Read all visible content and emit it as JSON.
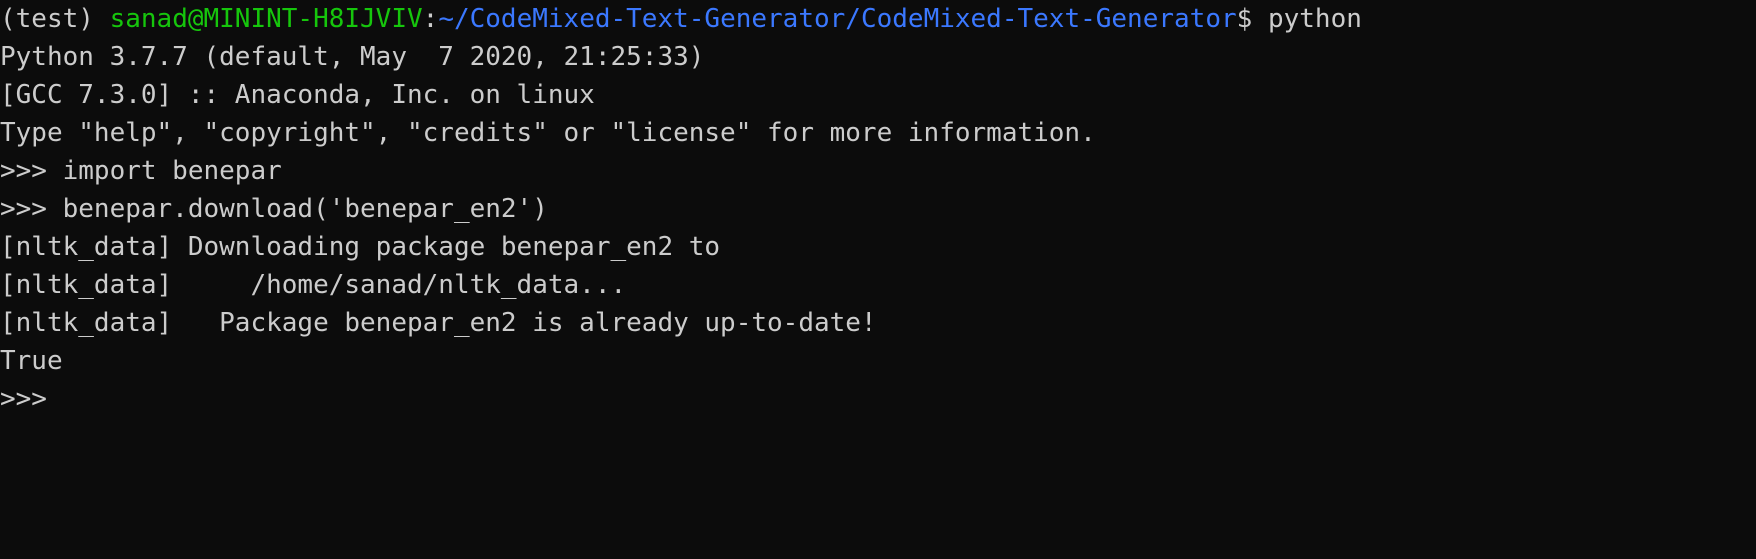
{
  "colors": {
    "background": "#0c0c0c",
    "foreground": "#cccccc",
    "user_host": "#16c60c",
    "path": "#3b78ff"
  },
  "prompt": {
    "env": "(test) ",
    "user_host": "sanad@MININT-H8IJVIV",
    "colon": ":",
    "path": "~/CodeMixed-Text-Generator/CodeMixed-Text-Generator",
    "symbol": "$ ",
    "command": "python"
  },
  "output": [
    "Python 3.7.7 (default, May  7 2020, 21:25:33)",
    "[GCC 7.3.0] :: Anaconda, Inc. on linux",
    "Type \"help\", \"copyright\", \"credits\" or \"license\" for more information.",
    ">>> import benepar",
    ">>> benepar.download('benepar_en2')",
    "[nltk_data] Downloading package benepar_en2 to",
    "[nltk_data]     /home/sanad/nltk_data...",
    "[nltk_data]   Package benepar_en2 is already up-to-date!",
    "True",
    ">>> "
  ]
}
